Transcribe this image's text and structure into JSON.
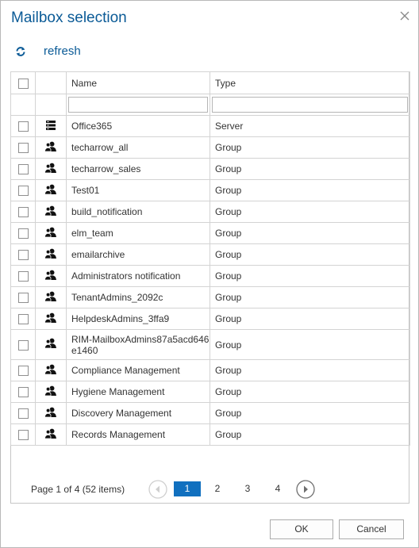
{
  "dialog": {
    "title": "Mailbox selection"
  },
  "toolbar": {
    "refresh_label": "refresh"
  },
  "grid": {
    "columns": {
      "name": "Name",
      "type": "Type"
    },
    "filters": {
      "name": "",
      "type": ""
    },
    "rows": [
      {
        "name": "Office365",
        "type": "Server",
        "icon": "server-icon"
      },
      {
        "name": "techarrow_all",
        "type": "Group",
        "icon": "group-icon"
      },
      {
        "name": "techarrow_sales",
        "type": "Group",
        "icon": "group-icon"
      },
      {
        "name": "Test01",
        "type": "Group",
        "icon": "group-icon"
      },
      {
        "name": "build_notification",
        "type": "Group",
        "icon": "group-icon"
      },
      {
        "name": "elm_team",
        "type": "Group",
        "icon": "group-icon"
      },
      {
        "name": "emailarchive",
        "type": "Group",
        "icon": "group-icon"
      },
      {
        "name": "Administrators notification",
        "type": "Group",
        "icon": "group-icon"
      },
      {
        "name": "TenantAdmins_2092c",
        "type": "Group",
        "icon": "group-icon"
      },
      {
        "name": "HelpdeskAdmins_3ffa9",
        "type": "Group",
        "icon": "group-icon"
      },
      {
        "name": "RIM-MailboxAdmins87a5acd646e1460",
        "type": "Group",
        "icon": "group-icon"
      },
      {
        "name": "Compliance Management",
        "type": "Group",
        "icon": "group-icon"
      },
      {
        "name": "Hygiene Management",
        "type": "Group",
        "icon": "group-icon"
      },
      {
        "name": "Discovery Management",
        "type": "Group",
        "icon": "group-icon"
      },
      {
        "name": "Records Management",
        "type": "Group",
        "icon": "group-icon"
      }
    ]
  },
  "pager": {
    "info": "Page 1 of 4 (52 items)",
    "pages": [
      "1",
      "2",
      "3",
      "4"
    ],
    "current_page": "1"
  },
  "buttons": {
    "ok": "OK",
    "cancel": "Cancel"
  },
  "colors": {
    "accent": "#0a5a96",
    "active_page": "#1170bf"
  }
}
